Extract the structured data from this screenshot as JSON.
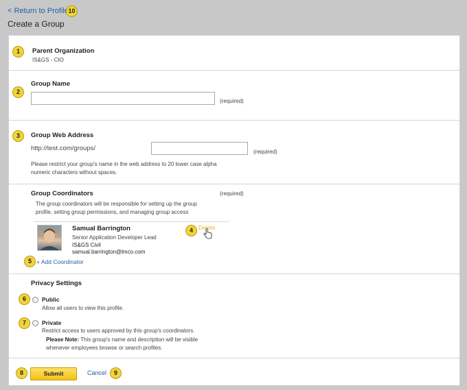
{
  "header": {
    "back_link": "< Return to Profile",
    "title": "Create a Group"
  },
  "badges": {
    "parent": "1",
    "name": "2",
    "web": "3",
    "delete": "4",
    "add": "5",
    "public": "6",
    "private": "7",
    "submit": "8",
    "cancel": "9",
    "back": "10"
  },
  "parent_org": {
    "label": "Parent Organization",
    "value": "IS&GS - CIO"
  },
  "group_name": {
    "label": "Group Name",
    "value": "",
    "required": "(required)"
  },
  "web_address": {
    "label": "Group Web Address",
    "prefix": "http://test.com/groups/",
    "value": "",
    "required": "(required)",
    "help_line1": "Please restrict your group's name in the web address to 20 lower case alpha",
    "help_line2": "numeric characters without spaces."
  },
  "coordinators": {
    "label": "Group Coordinators",
    "required": "(required)",
    "desc_line1": "The group coordinators will be responsible for setting up the group",
    "desc_line2": "profile, setting group permissions, and managing group access",
    "person": {
      "name": "Samual Barrington",
      "title": "Senior Application Developer Lead",
      "org": "IS&GS Civil",
      "email": "samual.barrington@lmco.com"
    },
    "delete_label": "Delete",
    "add_label": "+ Add Coordinator"
  },
  "privacy": {
    "label": "Privacy Settings",
    "public_label": "Public",
    "public_desc": "Allow  all users to view this profile.",
    "private_label": "Private",
    "private_desc": "Restrict access to users approved by this group's coordinators.",
    "note_label": "Please Note:",
    "note_line1": " This group's name and description will be visible",
    "note_line2": "whenever employees browse or search profiles."
  },
  "actions": {
    "submit_label": "Submit",
    "cancel_label": "Cancel"
  },
  "colors": {
    "link": "#1f5fa6",
    "badge": "#f2d43a",
    "delete": "#e8b430",
    "button": "#f2c21a"
  }
}
